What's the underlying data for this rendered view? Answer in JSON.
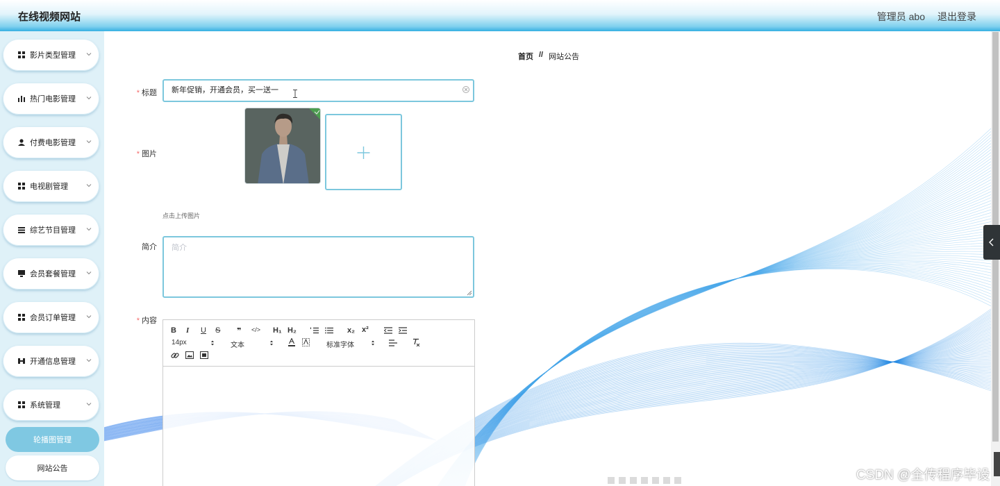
{
  "header": {
    "app_title": "在线视频网站",
    "user_label": "管理员 abo",
    "logout_label": "退出登录"
  },
  "sidebar": {
    "items": [
      {
        "label": "影片类型管理",
        "icon": "grid-icon"
      },
      {
        "label": "热门电影管理",
        "icon": "bar-chart-icon"
      },
      {
        "label": "付费电影管理",
        "icon": "user-icon"
      },
      {
        "label": "电视剧管理",
        "icon": "grid-icon"
      },
      {
        "label": "综艺节目管理",
        "icon": "list-icon"
      },
      {
        "label": "会员套餐管理",
        "icon": "monitor-icon"
      },
      {
        "label": "会员订单管理",
        "icon": "grid-icon"
      },
      {
        "label": "开通信息管理",
        "icon": "shuffle-icon"
      },
      {
        "label": "系统管理",
        "icon": "grid-icon"
      }
    ],
    "sub_items": [
      {
        "label": "轮播图管理",
        "active": true
      },
      {
        "label": "网站公告",
        "active": false
      }
    ]
  },
  "breadcrumb": {
    "home": "首页",
    "separator": "//",
    "current": "网站公告"
  },
  "form": {
    "title_label": "标题",
    "title_value": "新年促销，开通会员，买一送一",
    "image_label": "图片",
    "upload_hint": "点击上传图片",
    "intro_label": "简介",
    "intro_placeholder": "简介",
    "content_label": "内容",
    "required_mark": "*"
  },
  "editor": {
    "toolbar": {
      "bold": "B",
      "italic": "I",
      "underline": "U",
      "strike": "S",
      "quote": "❞",
      "code": "</>",
      "h1": "H₁",
      "h2": "H₂",
      "x_sub": "x₂",
      "x_sup": "x²",
      "font_size": "14px",
      "paragraph": "文本",
      "font_family": "标准字体"
    }
  },
  "watermark": "CSDN @全传程序毕设",
  "colors": {
    "accent": "#7cc7dd",
    "sidebar_bg": "#dff1f8",
    "required": "#f56c6c",
    "active_sub": "#7fc8e2"
  }
}
